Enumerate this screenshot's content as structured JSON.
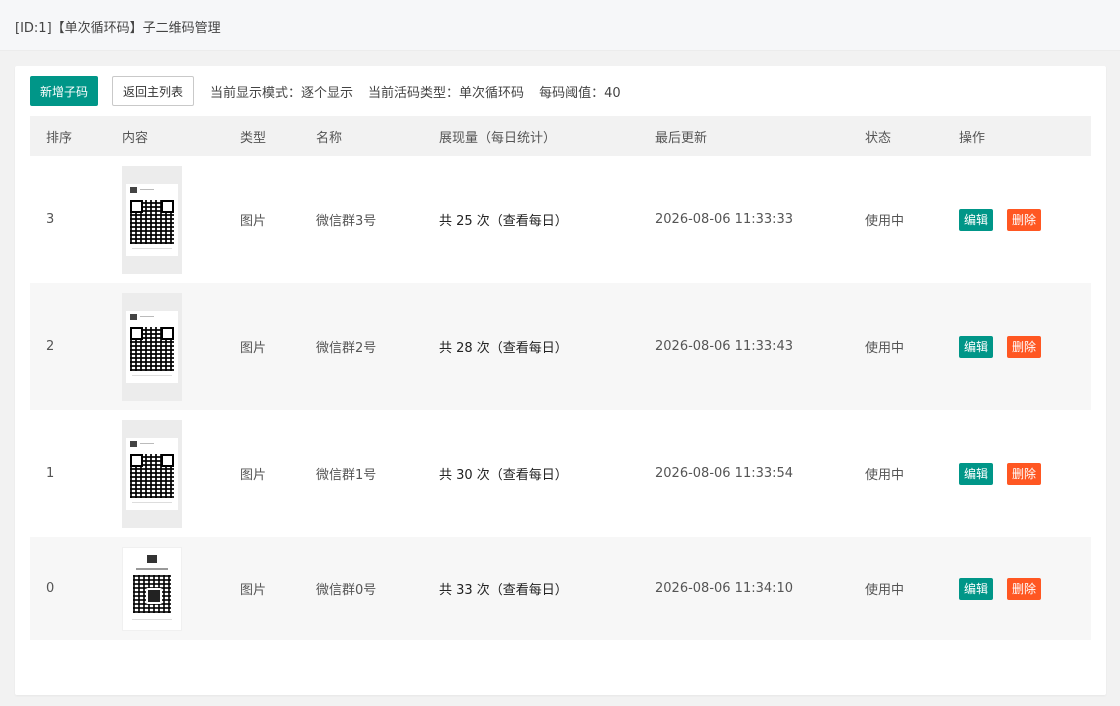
{
  "header": {
    "title": "[ID:1]【单次循环码】子二维码管理"
  },
  "toolbar": {
    "add_label": "新增子码",
    "back_label": "返回主列表",
    "display_mode": "当前显示模式：逐个显示",
    "code_type": "当前活码类型：单次循环码",
    "threshold": "每码阈值：40"
  },
  "table": {
    "columns": [
      "排序",
      "内容",
      "类型",
      "名称",
      "展现量（每日统计）",
      "最后更新",
      "状态",
      "操作"
    ],
    "rows": [
      {
        "order": "3",
        "type": "图片",
        "name": "微信群3号",
        "stats": "共 25 次（查看每日）",
        "updated": "2026-08-06 11:33:33",
        "status": "使用中",
        "edit": "编辑",
        "delete": "删除"
      },
      {
        "order": "2",
        "type": "图片",
        "name": "微信群2号",
        "stats": "共 28 次（查看每日）",
        "updated": "2026-08-06 11:33:43",
        "status": "使用中",
        "edit": "编辑",
        "delete": "删除"
      },
      {
        "order": "1",
        "type": "图片",
        "name": "微信群1号",
        "stats": "共 30 次（查看每日）",
        "updated": "2026-08-06 11:33:54",
        "status": "使用中",
        "edit": "编辑",
        "delete": "删除"
      },
      {
        "order": "0",
        "type": "图片",
        "name": "微信群0号",
        "stats": "共 33 次（查看每日）",
        "updated": "2026-08-06 11:34:10",
        "status": "使用中",
        "edit": "编辑",
        "delete": "删除"
      }
    ]
  },
  "icons": [
    "qr-code-thumbnail-icon"
  ],
  "colors": {
    "primary": "#009688",
    "danger": "#ff5722",
    "header_bg": "#f2f2f2"
  }
}
